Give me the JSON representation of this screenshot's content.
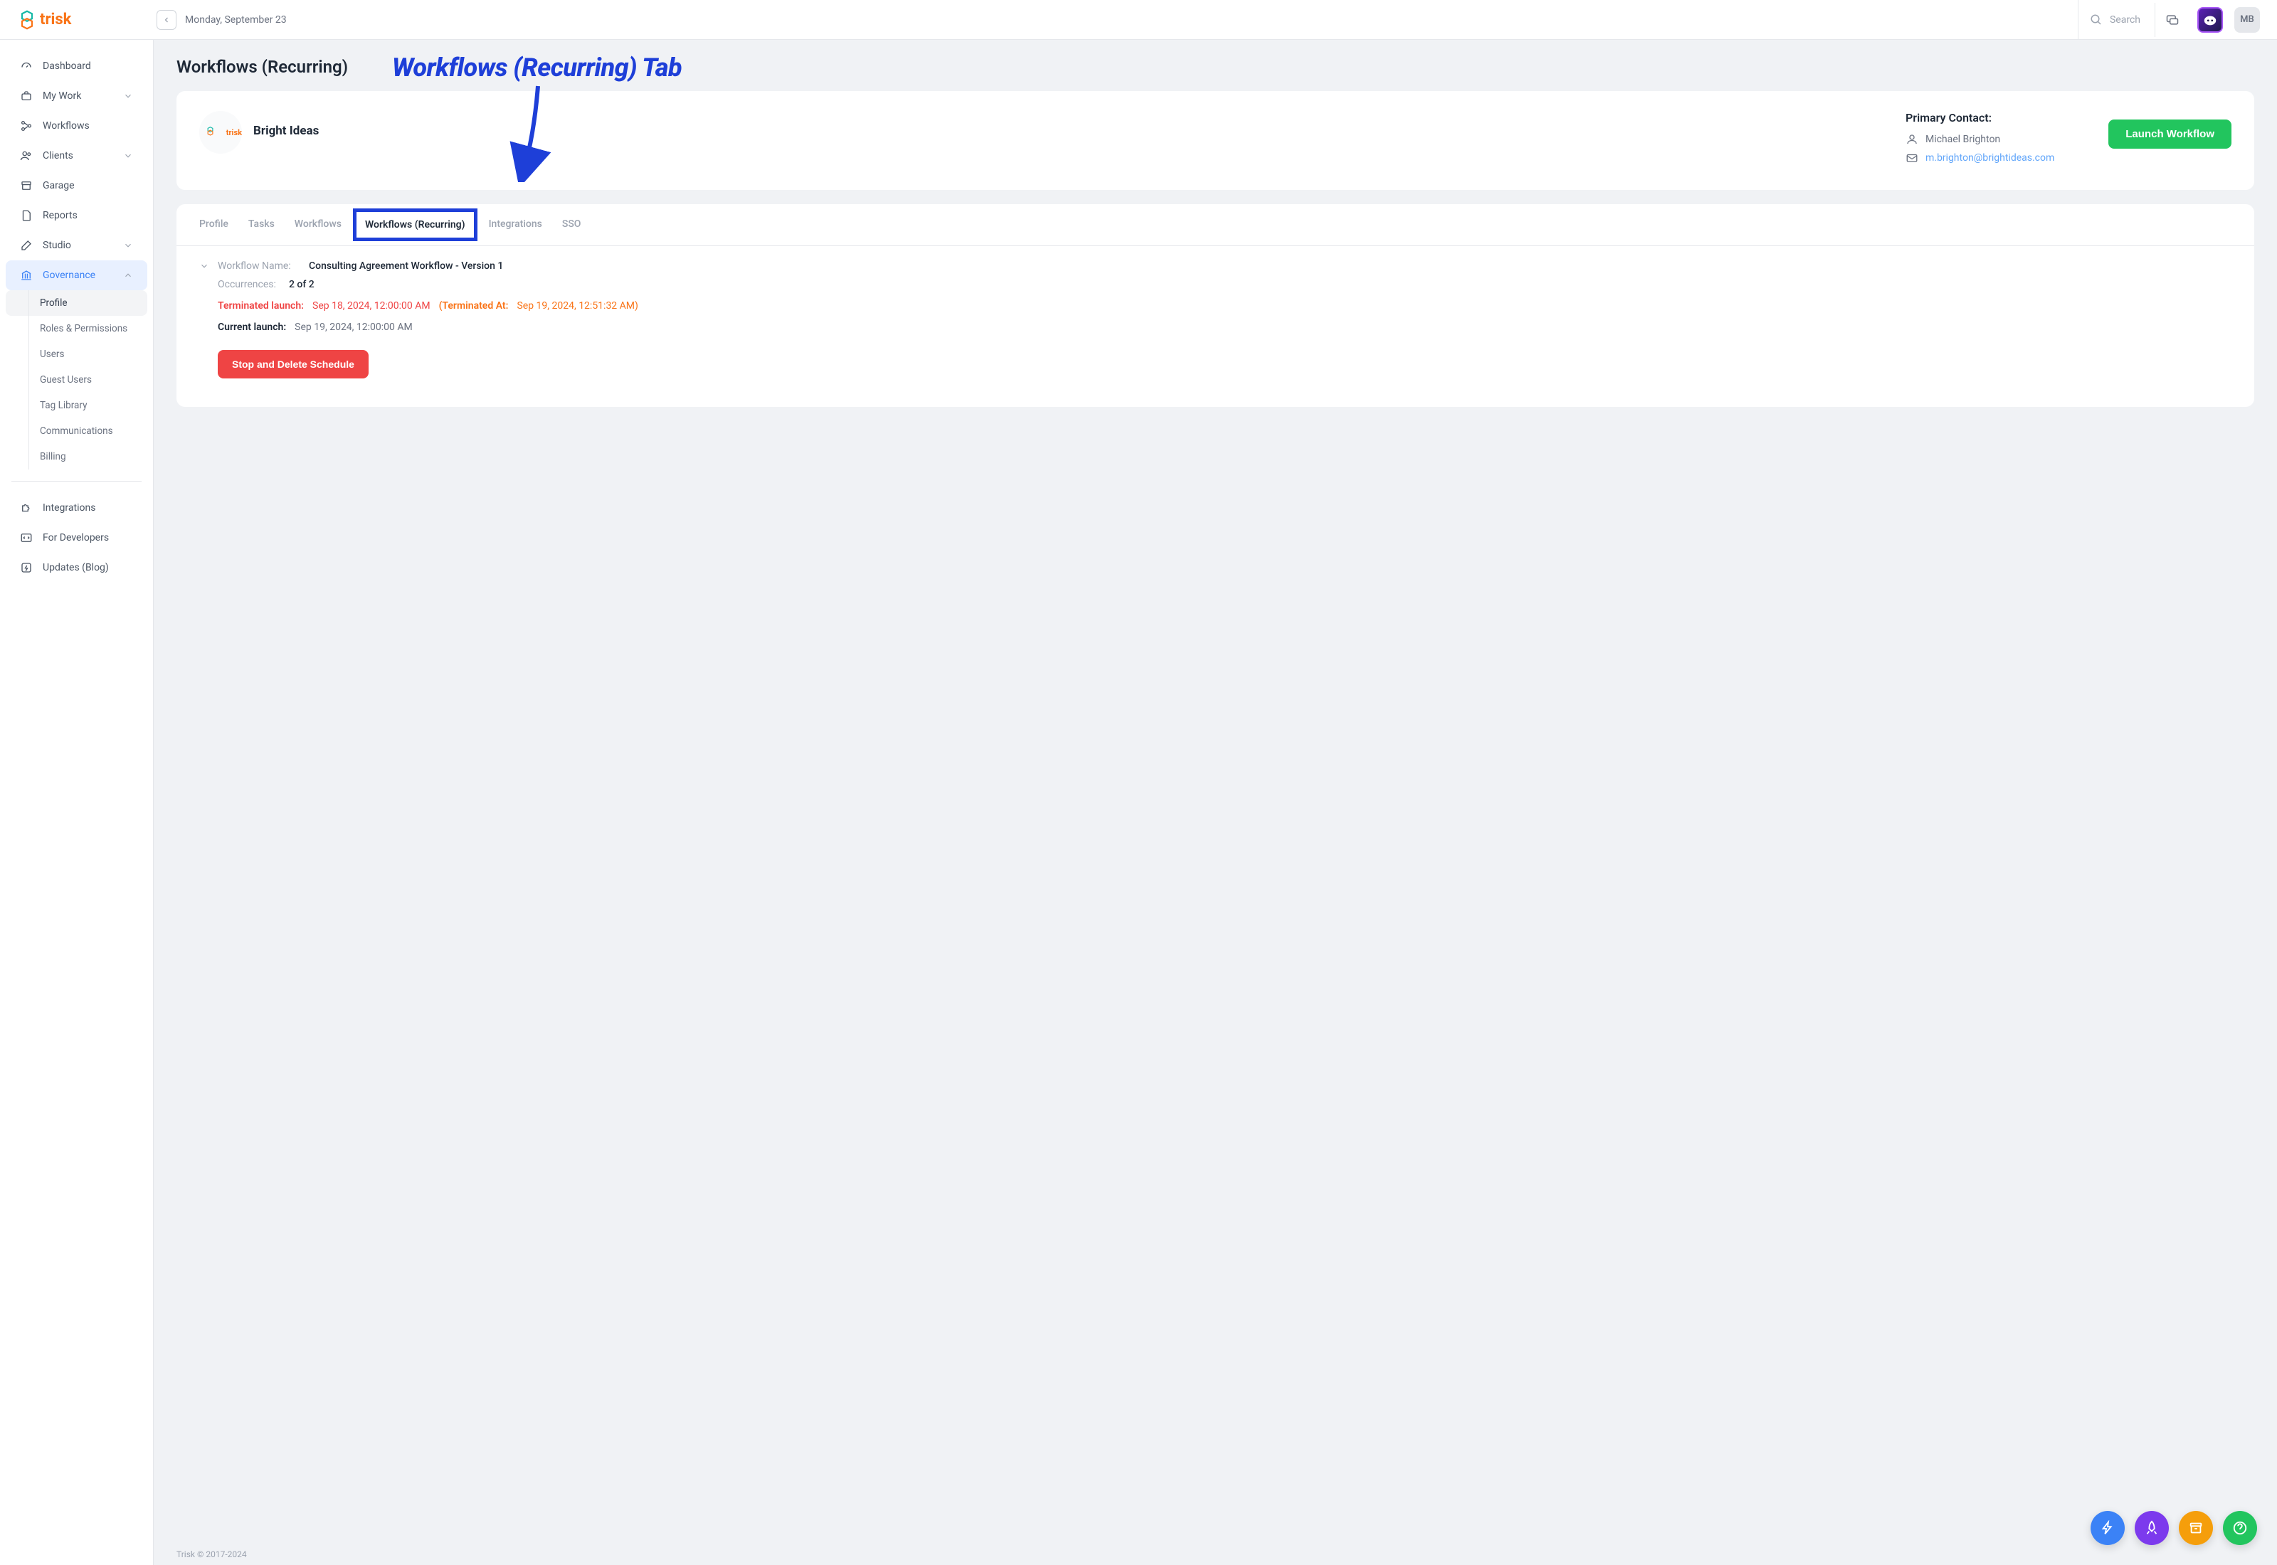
{
  "brand": "trisk",
  "date": "Monday, September 23",
  "search_placeholder": "Search",
  "user_initials": "MB",
  "annotation_text": "Workflows (Recurring) Tab",
  "sidebar": {
    "items": [
      {
        "label": "Dashboard"
      },
      {
        "label": "My Work"
      },
      {
        "label": "Workflows"
      },
      {
        "label": "Clients"
      },
      {
        "label": "Garage"
      },
      {
        "label": "Reports"
      },
      {
        "label": "Studio"
      },
      {
        "label": "Governance"
      }
    ],
    "gov_sub": [
      {
        "label": "Profile"
      },
      {
        "label": "Roles & Permissions"
      },
      {
        "label": "Users"
      },
      {
        "label": "Guest Users"
      },
      {
        "label": "Tag Library"
      },
      {
        "label": "Communications"
      },
      {
        "label": "Billing"
      }
    ],
    "footer_items": [
      {
        "label": "Integrations"
      },
      {
        "label": "For Developers"
      },
      {
        "label": "Updates (Blog)"
      }
    ]
  },
  "page_title": "Workflows (Recurring)",
  "client": {
    "name": "Bright Ideas",
    "contact_title": "Primary Contact:",
    "contact_name": "Michael Brighton",
    "contact_email": "m.brighton@brightideas.com",
    "launch_label": "Launch Workflow"
  },
  "tabs": [
    {
      "label": "Profile"
    },
    {
      "label": "Tasks"
    },
    {
      "label": "Workflows"
    },
    {
      "label": "Workflows (Recurring)"
    },
    {
      "label": "Integrations"
    },
    {
      "label": "SSO"
    }
  ],
  "workflow": {
    "name_label": "Workflow Name:",
    "name_value": "Consulting Agreement Workflow - Version 1",
    "occ_label": "Occurrences:",
    "occ_value": "2 of 2",
    "term_label": "Terminated launch:",
    "term_value": "Sep 18, 2024, 12:00:00 AM",
    "term_at_label": "(Terminated At:",
    "term_at_value": "Sep 19, 2024, 12:51:32 AM)",
    "current_label": "Current launch:",
    "current_value": "Sep 19, 2024, 12:00:00 AM",
    "delete_label": "Stop and Delete Schedule"
  },
  "footer": "Trisk © 2017-2024",
  "fab_colors": {
    "zap": "#3b82f6",
    "rocket": "#7c3aed",
    "archive": "#f59e0b",
    "help": "#22c55e"
  }
}
